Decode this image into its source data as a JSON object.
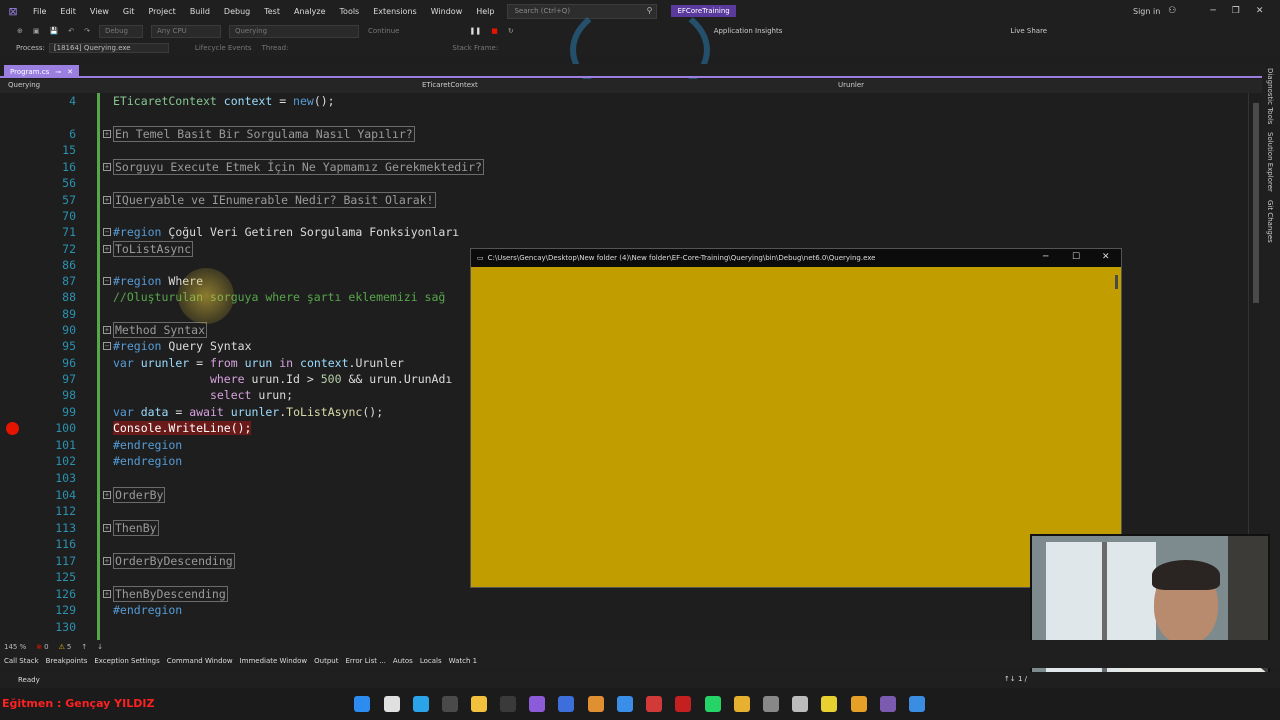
{
  "menubar": {
    "items": [
      "File",
      "Edit",
      "View",
      "Git",
      "Project",
      "Build",
      "Debug",
      "Test",
      "Analyze",
      "Tools",
      "Extensions",
      "Window",
      "Help"
    ],
    "search_placeholder": "Search (Ctrl+Q)",
    "project_name": "EFCoreTraining",
    "sign_in": "Sign in"
  },
  "toolbar": {
    "config": "Debug",
    "platform": "Any CPU",
    "startup": "Querying",
    "continue": "Continue",
    "app_insights": "Application Insights",
    "live_share": "Live Share"
  },
  "processbar": {
    "label": "Process:",
    "value": "[18164] Querying.exe",
    "lifecycle": "Lifecycle Events",
    "thread": "Thread:",
    "stack": "Stack Frame:"
  },
  "tab": {
    "filename": "Program.cs"
  },
  "navbar": {
    "project": "Querying",
    "class": "ETicaretContext",
    "member": "Urunler"
  },
  "code_lines": [
    {
      "ln": "4",
      "text": "ETicaretContext context = new();"
    },
    {
      "ln": "6",
      "text": "En Temel Basit Bir Sorgulama Nasıl Yapılır?"
    },
    {
      "ln": "15",
      "text": ""
    },
    {
      "ln": "16",
      "text": "Sorguyu Execute Etmek İçin Ne Yapmamız Gerekmektedir?"
    },
    {
      "ln": "56",
      "text": ""
    },
    {
      "ln": "57",
      "text": "IQueryable ve IEnumerable Nedir? Basit Olarak!"
    },
    {
      "ln": "70",
      "text": ""
    },
    {
      "ln": "71",
      "text": "#region Çoğul Veri Getiren Sorgulama Fonksiyonları"
    },
    {
      "ln": "72",
      "text": "ToListAsync"
    },
    {
      "ln": "86",
      "text": ""
    },
    {
      "ln": "87",
      "text": "#region Where"
    },
    {
      "ln": "88",
      "text": "//Oluşturulan sorguya where şartı eklememizi sağ"
    },
    {
      "ln": "89",
      "text": ""
    },
    {
      "ln": "90",
      "text": "Method Syntax"
    },
    {
      "ln": "95",
      "text": "#region Query Syntax"
    },
    {
      "ln": "96",
      "text": "var urunler = from urun in context.Urunler"
    },
    {
      "ln": "97",
      "text": "where urun.Id > 500 && urun.UrunAdı"
    },
    {
      "ln": "98",
      "text": "select urun;"
    },
    {
      "ln": "99",
      "text": "var data = await urunler.ToListAsync();"
    },
    {
      "ln": "100",
      "text": "Console.WriteLine();"
    },
    {
      "ln": "101",
      "text": "#endregion"
    },
    {
      "ln": "102",
      "text": "#endregion"
    },
    {
      "ln": "103",
      "text": ""
    },
    {
      "ln": "104",
      "text": "OrderBy"
    },
    {
      "ln": "112",
      "text": ""
    },
    {
      "ln": "113",
      "text": "ThenBy"
    },
    {
      "ln": "116",
      "text": ""
    },
    {
      "ln": "117",
      "text": "OrderByDescending"
    },
    {
      "ln": "125",
      "text": ""
    },
    {
      "ln": "126",
      "text": "ThenByDescending"
    },
    {
      "ln": "129",
      "text": "#endregion"
    },
    {
      "ln": "130",
      "text": ""
    }
  ],
  "console": {
    "title": "C:\\Users\\Gencay\\Desktop\\New folder (4)\\New folder\\EF-Core-Training\\Querying\\bin\\Debug\\net6.0\\Querying.exe",
    "background": "#c19d00"
  },
  "sidepanel": {
    "items": [
      "Diagnostic Tools",
      "Solution Explorer",
      "Git Changes"
    ]
  },
  "bottomtools": {
    "zoom": "145 %",
    "errors": "0",
    "warnings": "5"
  },
  "windowlist": {
    "items": [
      "Call Stack",
      "Breakpoints",
      "Exception Settings",
      "Command Window",
      "Immediate Window",
      "Output",
      "Error List ...",
      "Autos",
      "Locals",
      "Watch 1"
    ]
  },
  "statusbar": {
    "ready": "Ready",
    "position": "↑↓ 1 /"
  },
  "watermark": {
    "text": "Eğitmen : Gençay YILDIZ"
  }
}
